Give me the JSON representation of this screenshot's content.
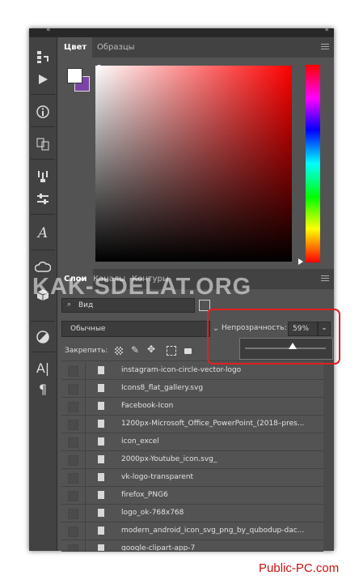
{
  "color_panel": {
    "tabs": [
      {
        "label": "Цвет",
        "active": true
      },
      {
        "label": "Образцы",
        "active": false
      }
    ],
    "foreground_color": "#ffffff",
    "background_color": "#7b45a5",
    "hue": "#ff0000"
  },
  "layers_panel": {
    "tabs": [
      {
        "label": "Слои",
        "active": true
      },
      {
        "label": "Каналы",
        "active": false
      },
      {
        "label": "Контуры",
        "active": false
      }
    ],
    "filter_kind": "Вид",
    "blend_mode": "Обычные",
    "opacity_label": "Непрозрачность:",
    "opacity_value": "59%",
    "opacity_fraction": 0.59,
    "lock_label": "Закрепить:",
    "layers": [
      "instagram-icon-circle-vector-logo",
      "Icons8_flat_gallery.svg",
      "Facebook-Icon",
      "1200px-Microsoft_Office_PowerPoint_(2018–pres...",
      "icon_excel",
      "2000px-Youtube_icon.svg_",
      "vk-logo-transparent",
      "firefox_PNG6",
      "logo_ok-768x768",
      "modern_android_icon_svg_png_by_qubodup-dac...",
      "google-clipart-app-7"
    ]
  },
  "watermark": "KAK-SDELAT.ORG",
  "credit": "Public-PC.com",
  "highlight_color": "#e02020"
}
